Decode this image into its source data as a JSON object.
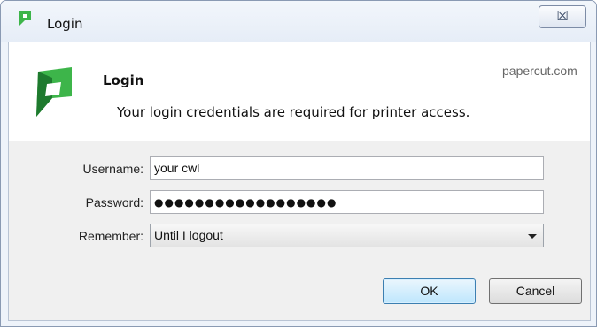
{
  "window": {
    "title": "Login",
    "close_glyph": "☒"
  },
  "header": {
    "title": "Login",
    "site": "papercut.com",
    "description": "Your login credentials are required for printer access."
  },
  "form": {
    "username": {
      "label": "Username:",
      "value": "your cwl"
    },
    "password": {
      "label": "Password:",
      "masked_value": "●●●●●●●●●●●●●●●●●●"
    },
    "remember": {
      "label": "Remember:",
      "selected": "Until I logout"
    }
  },
  "buttons": {
    "ok": "OK",
    "cancel": "Cancel"
  },
  "icons": {
    "app_icon": "papercut-logo-icon",
    "close": "close-icon",
    "dropdown": "chevron-down-icon"
  },
  "colors": {
    "brand_green": "#3db54a",
    "brand_dark_green": "#1e7a2e",
    "default_button_border": "#3c7fb1"
  }
}
